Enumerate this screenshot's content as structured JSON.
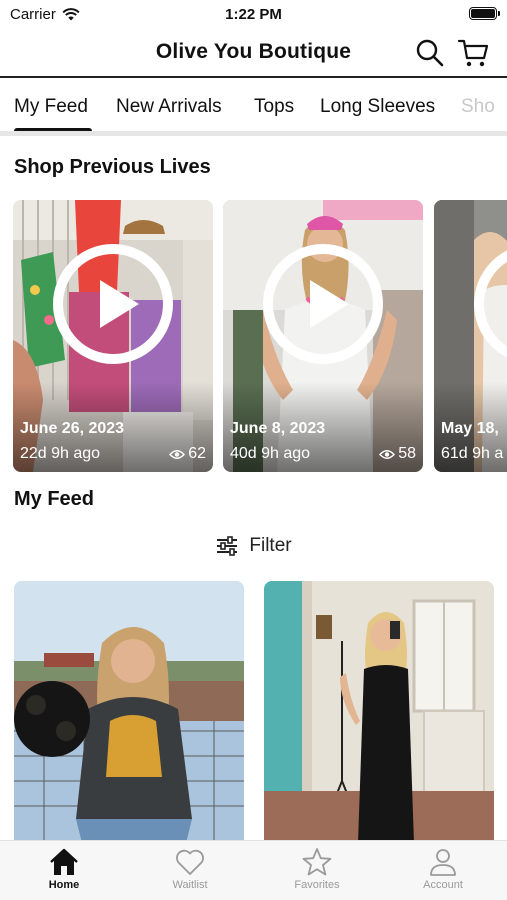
{
  "status_bar": {
    "carrier": "Carrier",
    "time": "1:22 PM"
  },
  "header": {
    "title": "Olive You Boutique",
    "search_icon": "search-icon",
    "cart_icon": "cart-icon"
  },
  "tabs": [
    {
      "label": "My Feed",
      "active": true
    },
    {
      "label": "New Arrivals"
    },
    {
      "label": "Tops"
    },
    {
      "label": "Long Sleeves"
    },
    {
      "label": "Sho"
    }
  ],
  "previous_lives": {
    "title": "Shop Previous Lives",
    "items": [
      {
        "date": "June 26, 2023",
        "ago": "22d 9h ago",
        "views": "62"
      },
      {
        "date": "June 8, 2023",
        "ago": "40d 9h ago",
        "views": "58"
      },
      {
        "date": "May 18,",
        "ago": "61d 9h a",
        "views": ""
      }
    ]
  },
  "feed": {
    "title": "My Feed",
    "filter_label": "Filter"
  },
  "bottom_nav": [
    {
      "label": "Home",
      "icon": "home-icon",
      "active": true
    },
    {
      "label": "Waitlist",
      "icon": "heart-icon"
    },
    {
      "label": "Favorites",
      "icon": "star-icon"
    },
    {
      "label": "Account",
      "icon": "person-icon"
    }
  ],
  "colors": {
    "text": "#111111",
    "nav_inactive": "#9a9a9a",
    "tab_faded": "#c8c8c8",
    "divider": "#e6e6e6"
  }
}
